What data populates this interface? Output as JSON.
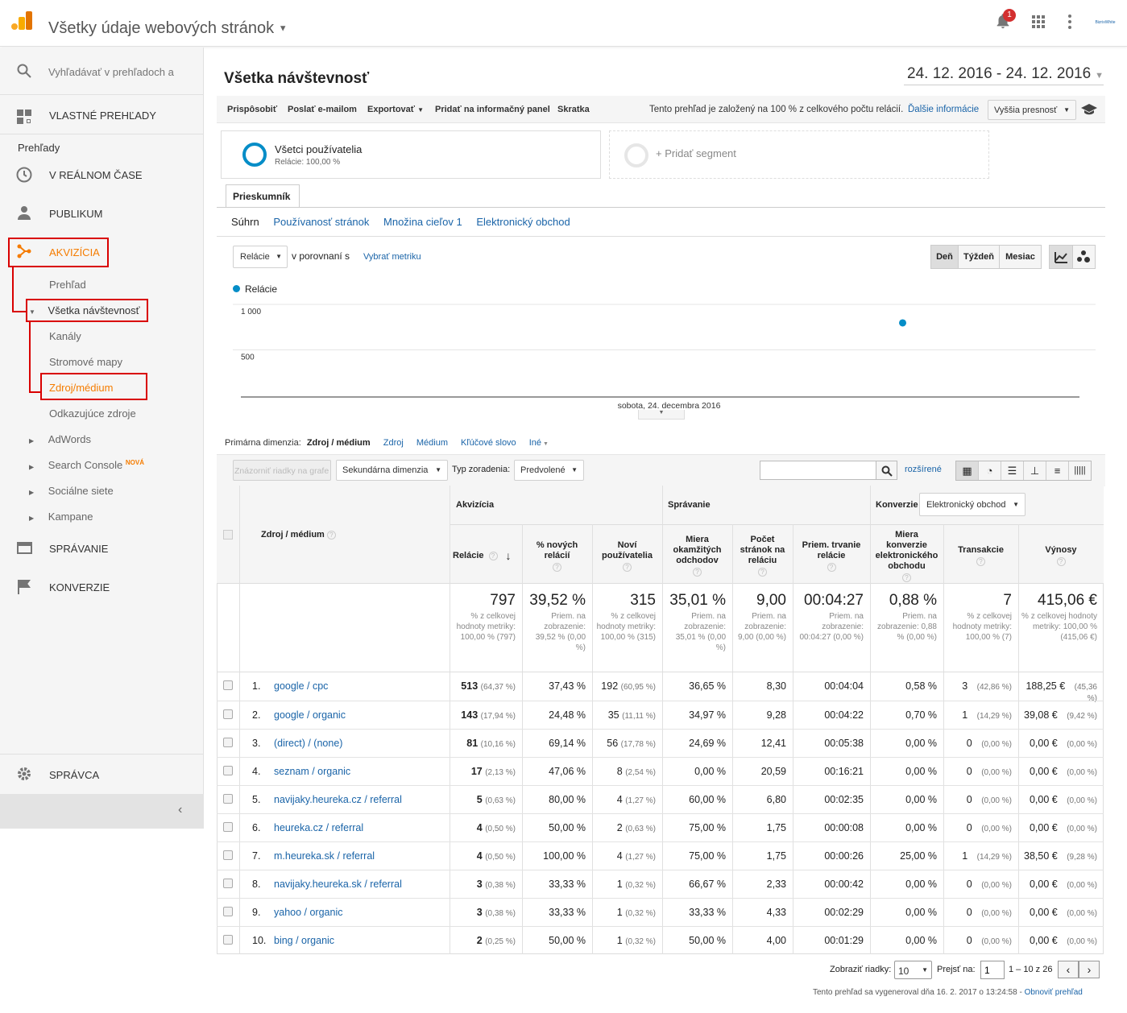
{
  "header": {
    "title": "Všetky údaje webových stránok",
    "notif_count": "1",
    "account_logo": "BizrixWhite"
  },
  "search": {
    "placeholder": "Vyhľadávať v prehľadoch a"
  },
  "sidebar": {
    "custom_reports": "VLASTNÉ PREHĽADY",
    "reports_heading": "Prehľady",
    "realtime": "V REÁLNOM ČASE",
    "audience": "PUBLIKUM",
    "acquisition": "AKVIZÍCIA",
    "overview": "Prehľad",
    "all_traffic": "Všetka návštevnosť",
    "channels": "Kanály",
    "treemaps": "Stromové mapy",
    "source_medium": "Zdroj/médium",
    "referrals": "Odkazujúce zdroje",
    "adwords": "AdWords",
    "search_console": "Search Console",
    "new_badge": "NOVÁ",
    "social": "Sociálne siete",
    "campaigns": "Kampane",
    "behavior": "SPRÁVANIE",
    "conversions": "KONVERZIE",
    "admin": "SPRÁVCA"
  },
  "report": {
    "title": "Všetka návštevnosť",
    "date_range": "24. 12. 2016 - 24. 12. 2016",
    "toolbar": {
      "customize": "Prispôsobiť",
      "email": "Poslať e-mailom",
      "export": "Exportovať",
      "dashboard": "Pridať na informačný panel",
      "shortcut": "Skratka"
    },
    "sampling_note": "Tento prehľad je založený na 100 % z celkového počtu relácií.",
    "more_info": "Ďalšie informácie",
    "precision": "Vyššia presnosť",
    "segment": {
      "name": "Všetci používatelia",
      "sub": "Relácie: 100,00 %",
      "add": "+ Pridať segment"
    },
    "explorer_tab": "Prieskumník",
    "subtabs": [
      "Súhrn",
      "Používanosť stránok",
      "Množina cieľov 1",
      "Elektronický obchod"
    ],
    "metric_select": "Relácie",
    "vs": "v porovnaní s",
    "choose_metric": "Vybrať metriku",
    "periods": [
      "Deň",
      "Týždeň",
      "Mesiac"
    ],
    "legend": "Relácie",
    "primary_dim_label": "Primárna dimenzia:",
    "primary_dims": [
      "Zdroj / médium",
      "Zdroj",
      "Médium",
      "Kľúčové slovo",
      "Iné"
    ],
    "plot_rows": "Znázorniť riadky na grafe",
    "secondary_dim": "Sekundárna dimenzia",
    "sort_type_label": "Typ zoradenia:",
    "sort_type": "Predvolené",
    "advanced": "rozšírené",
    "conv_select": "Elektronický obchod"
  },
  "chart_data": {
    "type": "line",
    "x": [
      "sobota, 24. decembra 2016"
    ],
    "series": [
      {
        "name": "Relácie",
        "values": [
          797
        ]
      }
    ],
    "yticks": [
      "1 000",
      "500"
    ],
    "ylim": [
      0,
      1000
    ]
  },
  "table": {
    "group_headers": [
      "Akvizícia",
      "Správanie",
      "Konverzie"
    ],
    "dim_header": "Zdroj / médium",
    "columns": [
      "Relácie",
      "% nových relácií",
      "Noví používatelia",
      "Miera okamžitých odchodov",
      "Počet stránok na reláciu",
      "Priem. trvanie relácie",
      "Miera konverzie elektronického obchodu",
      "Transakcie",
      "Výnosy"
    ],
    "totals": [
      {
        "v": "797",
        "s": "% z celkovej hodnoty metriky: 100,00 % (797)"
      },
      {
        "v": "39,52 %",
        "s": "Priem. na zobrazenie: 39,52 % (0,00 %)"
      },
      {
        "v": "315",
        "s": "% z celkovej hodnoty metriky: 100,00 % (315)"
      },
      {
        "v": "35,01 %",
        "s": "Priem. na zobrazenie: 35,01 % (0,00 %)"
      },
      {
        "v": "9,00",
        "s": "Priem. na zobrazenie: 9,00 (0,00 %)"
      },
      {
        "v": "00:04:27",
        "s": "Priem. na zobrazenie: 00:04:27 (0,00 %)"
      },
      {
        "v": "0,88 %",
        "s": "Priem. na zobrazenie: 0,88 % (0,00 %)"
      },
      {
        "v": "7",
        "s": "% z celkovej hodnoty metriky: 100,00 % (7)"
      },
      {
        "v": "415,06 €",
        "s": "% z celkovej hodnoty metriky: 100,00 % (415,06 €)"
      }
    ],
    "rows": [
      {
        "n": "1.",
        "src": "google / cpc",
        "ses": "513",
        "sesp": "(64,37 %)",
        "nw": "37,43 %",
        "nu": "192",
        "nup": "(60,95 %)",
        "br": "36,65 %",
        "pp": "8,30",
        "dur": "00:04:04",
        "cr": "0,58 %",
        "tr": "3",
        "trp": "(42,86 %)",
        "rev": "188,25 €",
        "revp": "(45,36 %)"
      },
      {
        "n": "2.",
        "src": "google / organic",
        "ses": "143",
        "sesp": "(17,94 %)",
        "nw": "24,48 %",
        "nu": "35",
        "nup": "(11,11 %)",
        "br": "34,97 %",
        "pp": "9,28",
        "dur": "00:04:22",
        "cr": "0,70 %",
        "tr": "1",
        "trp": "(14,29 %)",
        "rev": "39,08 €",
        "revp": "(9,42 %)"
      },
      {
        "n": "3.",
        "src": "(direct) / (none)",
        "ses": "81",
        "sesp": "(10,16 %)",
        "nw": "69,14 %",
        "nu": "56",
        "nup": "(17,78 %)",
        "br": "24,69 %",
        "pp": "12,41",
        "dur": "00:05:38",
        "cr": "0,00 %",
        "tr": "0",
        "trp": "(0,00 %)",
        "rev": "0,00 €",
        "revp": "(0,00 %)"
      },
      {
        "n": "4.",
        "src": "seznam / organic",
        "ses": "17",
        "sesp": "(2,13 %)",
        "nw": "47,06 %",
        "nu": "8",
        "nup": "(2,54 %)",
        "br": "0,00 %",
        "pp": "20,59",
        "dur": "00:16:21",
        "cr": "0,00 %",
        "tr": "0",
        "trp": "(0,00 %)",
        "rev": "0,00 €",
        "revp": "(0,00 %)"
      },
      {
        "n": "5.",
        "src": "navijaky.heureka.cz / referral",
        "ses": "5",
        "sesp": "(0,63 %)",
        "nw": "80,00 %",
        "nu": "4",
        "nup": "(1,27 %)",
        "br": "60,00 %",
        "pp": "6,80",
        "dur": "00:02:35",
        "cr": "0,00 %",
        "tr": "0",
        "trp": "(0,00 %)",
        "rev": "0,00 €",
        "revp": "(0,00 %)"
      },
      {
        "n": "6.",
        "src": "heureka.cz / referral",
        "ses": "4",
        "sesp": "(0,50 %)",
        "nw": "50,00 %",
        "nu": "2",
        "nup": "(0,63 %)",
        "br": "75,00 %",
        "pp": "1,75",
        "dur": "00:00:08",
        "cr": "0,00 %",
        "tr": "0",
        "trp": "(0,00 %)",
        "rev": "0,00 €",
        "revp": "(0,00 %)"
      },
      {
        "n": "7.",
        "src": "m.heureka.sk / referral",
        "ses": "4",
        "sesp": "(0,50 %)",
        "nw": "100,00 %",
        "nu": "4",
        "nup": "(1,27 %)",
        "br": "75,00 %",
        "pp": "1,75",
        "dur": "00:00:26",
        "cr": "25,00 %",
        "tr": "1",
        "trp": "(14,29 %)",
        "rev": "38,50 €",
        "revp": "(9,28 %)"
      },
      {
        "n": "8.",
        "src": "navijaky.heureka.sk / referral",
        "ses": "3",
        "sesp": "(0,38 %)",
        "nw": "33,33 %",
        "nu": "1",
        "nup": "(0,32 %)",
        "br": "66,67 %",
        "pp": "2,33",
        "dur": "00:00:42",
        "cr": "0,00 %",
        "tr": "0",
        "trp": "(0,00 %)",
        "rev": "0,00 €",
        "revp": "(0,00 %)"
      },
      {
        "n": "9.",
        "src": "yahoo / organic",
        "ses": "3",
        "sesp": "(0,38 %)",
        "nw": "33,33 %",
        "nu": "1",
        "nup": "(0,32 %)",
        "br": "33,33 %",
        "pp": "4,33",
        "dur": "00:02:29",
        "cr": "0,00 %",
        "tr": "0",
        "trp": "(0,00 %)",
        "rev": "0,00 €",
        "revp": "(0,00 %)"
      },
      {
        "n": "10.",
        "src": "bing / organic",
        "ses": "2",
        "sesp": "(0,25 %)",
        "nw": "50,00 %",
        "nu": "1",
        "nup": "(0,32 %)",
        "br": "50,00 %",
        "pp": "4,00",
        "dur": "00:01:29",
        "cr": "0,00 %",
        "tr": "0",
        "trp": "(0,00 %)",
        "rev": "0,00 €",
        "revp": "(0,00 %)"
      }
    ]
  },
  "pager": {
    "rows_label": "Zobraziť riadky:",
    "rows_value": "10",
    "goto_label": "Prejsť na:",
    "goto_value": "1",
    "range": "1 – 10 z 26"
  },
  "footer": {
    "generated": "Tento prehľad sa vygeneroval dňa 16. 2. 2017 o 13:24:58 -",
    "refresh": "Obnoviť prehľad"
  },
  "colors": {
    "accent": "#f57c00",
    "link": "#1a64a8",
    "highlight": "#d90000",
    "chart_point": "#058dc7"
  }
}
